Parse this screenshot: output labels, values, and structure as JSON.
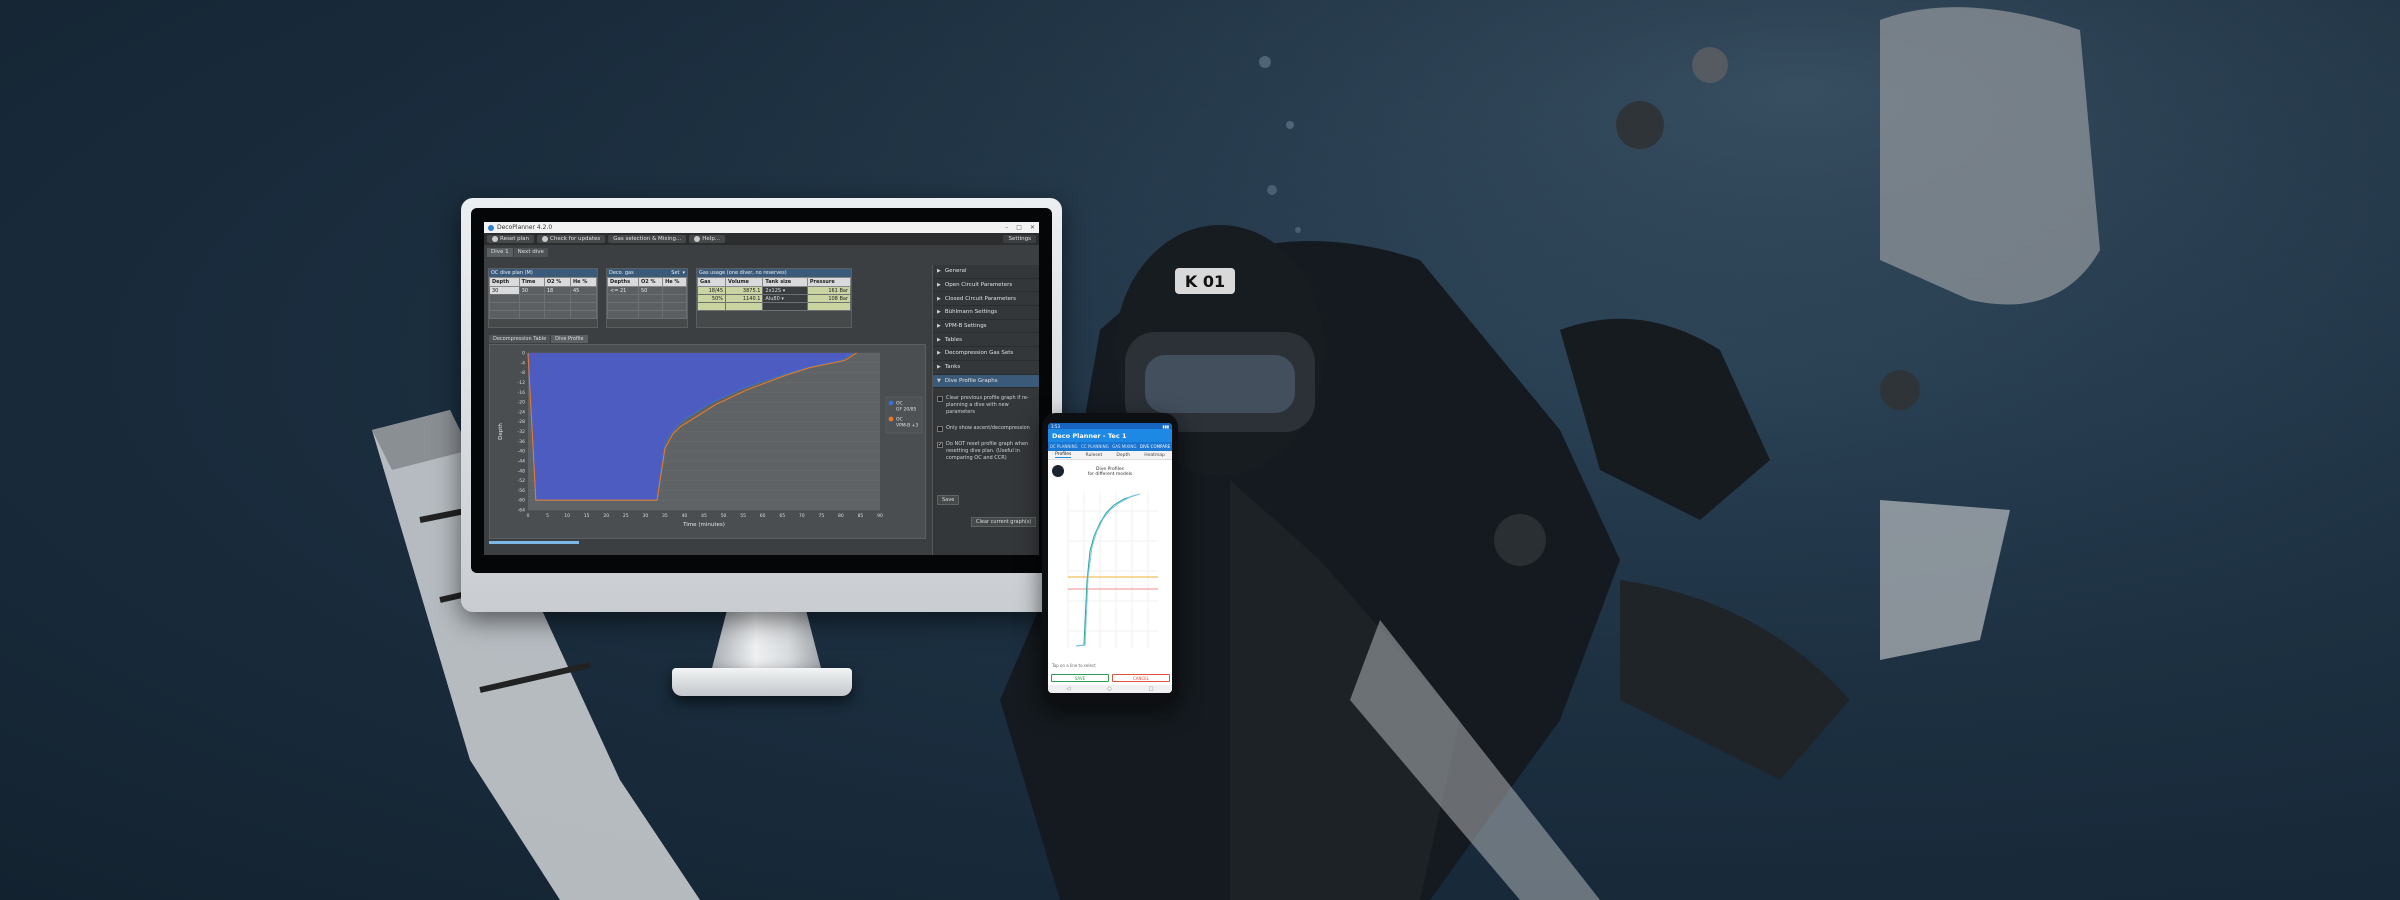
{
  "colors": {
    "accent": "#2f7fd0",
    "ocLine": "#3b6fd1",
    "vpmLine": "#e07a2e",
    "phoneBlue": "#1e88e5"
  },
  "app": {
    "title": "DecoPlanner 4.2.0",
    "toolbar": [
      "Reset plan",
      "Check for updates",
      "Gas selection & Mixing...",
      "Help..."
    ],
    "settings": "Settings",
    "dive_tabs": [
      "Dive 1",
      "Next dive"
    ]
  },
  "oc_plan": {
    "header": "OC dive plan (M)",
    "columns": [
      "Depth",
      "Time",
      "O2 %",
      "He %"
    ],
    "row": [
      "30",
      "30",
      "18",
      "45"
    ]
  },
  "deco_gas": {
    "header": "Deco. gas",
    "set_label": "Set",
    "columns": [
      "Depths",
      "O2 %",
      "He %"
    ],
    "row": [
      "<= 21",
      "50",
      ""
    ]
  },
  "gas_usage": {
    "header": "Gas usage (one diver, no reserves)",
    "columns": [
      "Gas",
      "Volume",
      "Tank size",
      "Pressure"
    ],
    "rows": [
      [
        "18/45",
        "3875.1",
        "2x12S",
        "161 Bar"
      ],
      [
        "50%",
        "1140.1",
        "Alu80",
        "108 Bar"
      ]
    ]
  },
  "chart_tabs": [
    "Decompression Table",
    "Dive Profile"
  ],
  "sidebar": {
    "items": [
      "General",
      "Open Circuit Parameters",
      "Closed Circuit Parameters",
      "Bühlmann Settings",
      "VPM-B Settings",
      "Tables",
      "Decompression Gas Sets",
      "Tanks",
      "Dive Profile Graphs"
    ],
    "options": [
      {
        "text": "Clear previous profile graph if re-planning a dive with new parameters",
        "checked": false
      },
      {
        "text": "Only show ascent/decompression",
        "checked": false
      },
      {
        "text": "Do NOT reset profile graph when resetting dive plan. (Useful in comparing OC and CCR)",
        "checked": true
      }
    ],
    "save_label": "Save",
    "clear_label": "Clear current graph(s)"
  },
  "chart_data": {
    "type": "line",
    "title": "",
    "xlabel": "Time (minutes)",
    "ylabel": "Depth",
    "xlim": [
      0,
      90
    ],
    "ylim": [
      -64,
      0
    ],
    "xticks": [
      0,
      5,
      10,
      15,
      20,
      25,
      30,
      35,
      40,
      45,
      50,
      55,
      60,
      65,
      70,
      75,
      80,
      85,
      90
    ],
    "yticks": [
      0,
      -4,
      -8,
      -12,
      -16,
      -20,
      -24,
      -28,
      -32,
      -36,
      -40,
      -44,
      -48,
      -52,
      -56,
      -60,
      -64
    ],
    "series": [
      {
        "name": "OC\nGF 20/85",
        "points": [
          [
            0,
            0
          ],
          [
            2,
            -60
          ],
          [
            33,
            -60
          ],
          [
            35,
            -37
          ],
          [
            36,
            -34
          ],
          [
            38,
            -30
          ],
          [
            40,
            -27
          ],
          [
            43,
            -24
          ],
          [
            46,
            -21
          ],
          [
            50,
            -18
          ],
          [
            54,
            -15
          ],
          [
            59,
            -12
          ],
          [
            65,
            -9
          ],
          [
            71,
            -6
          ],
          [
            80,
            -3
          ],
          [
            83,
            0
          ]
        ]
      },
      {
        "name": "OC\nVPM-B +3",
        "points": [
          [
            0,
            0
          ],
          [
            2,
            -60
          ],
          [
            33,
            -60
          ],
          [
            35,
            -39
          ],
          [
            37,
            -33
          ],
          [
            39,
            -30
          ],
          [
            42,
            -27
          ],
          [
            45,
            -24
          ],
          [
            48,
            -21
          ],
          [
            52,
            -18
          ],
          [
            56,
            -15
          ],
          [
            61,
            -12
          ],
          [
            66,
            -9
          ],
          [
            72,
            -6
          ],
          [
            81,
            -3
          ],
          [
            84,
            0
          ]
        ]
      }
    ],
    "legend": "right"
  },
  "phone": {
    "status_time": "3:53",
    "app_title": "Deco Planner - Tec 1",
    "tabs_top": [
      "OC PLANNING",
      "CC PLANNING",
      "GAS MIXING",
      "DIVE COMPARE"
    ],
    "tabs_sub": [
      "Profiles",
      "Ruleset",
      "Depth",
      "Heatmap"
    ],
    "chart_title": "Dive Profiles",
    "chart_subtitle": "for different models",
    "footer_note": "Tap on a line to select",
    "btn_left": "SAVE",
    "btn_right": "CANCEL"
  }
}
